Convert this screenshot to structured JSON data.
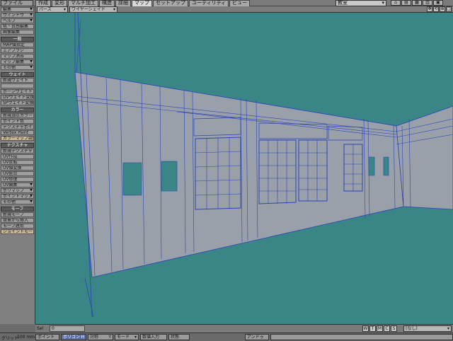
{
  "top_menu": {
    "file": "ファイル",
    "tabs": [
      {
        "label": "作成"
      },
      {
        "label": "変形"
      },
      {
        "label": "マルチ加工"
      },
      {
        "label": "構造"
      },
      {
        "label": "詳細"
      },
      {
        "label": "マップ",
        "active": true
      },
      {
        "label": "セットアップ"
      },
      {
        "label": "ユーティリティ"
      },
      {
        "label": "ビュー"
      }
    ],
    "scene": "教室"
  },
  "toolbar": {
    "menus": [
      "編集",
      "ウィンドウ",
      "ヘルプ"
    ],
    "top_items": [
      "色・質感編集",
      "画像編集"
    ],
    "general_header": "一般",
    "general_items": [
      "MAP値指定",
      "エアブラシ",
      "マップ消去",
      "マップ編集",
      "その他"
    ],
    "weight_header": "ウェイト",
    "weight_items": [
      "新規ウェイト",
      "",
      "ボーンウェイト",
      "UVウェイト変換",
      "SPウェイト変換"
    ],
    "color_header": "カラー",
    "color_items": [
      "新規頂点カラー",
      "ポイント色",
      "テクスチャポイント",
      "Vertex Paint",
      "カラーマップ調整"
    ],
    "texture_header": "テクスチャ",
    "texture_items": [
      "新規テクスチャ",
      "UV作成",
      "UV反転",
      "UV値変換",
      "UV統合",
      "UV修復",
      "UV編集",
      "ポリマップ",
      "ポイントマップ",
      "その他"
    ],
    "morph_header": "モーフ",
    "morph_items": [
      "新規モーフ",
      "背景から挿入",
      "モーフ適用",
      "ジョイントモーフ作成"
    ]
  },
  "viewport": {
    "projection": "パース",
    "shading": "ワイヤーシェイド",
    "icons": [
      "move-icon",
      "rotate-icon",
      "zoom-icon",
      "maximize-icon"
    ],
    "colors": {
      "background": "#3a8585",
      "wall": "#9aa0aa",
      "edge": "#2a44b8"
    }
  },
  "status": {
    "sel_label": "Sel",
    "sel_value": "0",
    "modes": [
      "W",
      "T",
      "M",
      "C",
      "S"
    ],
    "layer": "(なし)"
  },
  "bottom": {
    "grid_label": "グリッド",
    "grid_value": "100 mm",
    "point": "ポイント",
    "polygon": "ポリゴン",
    "h": "H",
    "symmetry": "対称",
    "y": "Y",
    "mode": "モード",
    "numeric": "数値入力",
    "state": "状態",
    "undo": "アンドゥ"
  }
}
